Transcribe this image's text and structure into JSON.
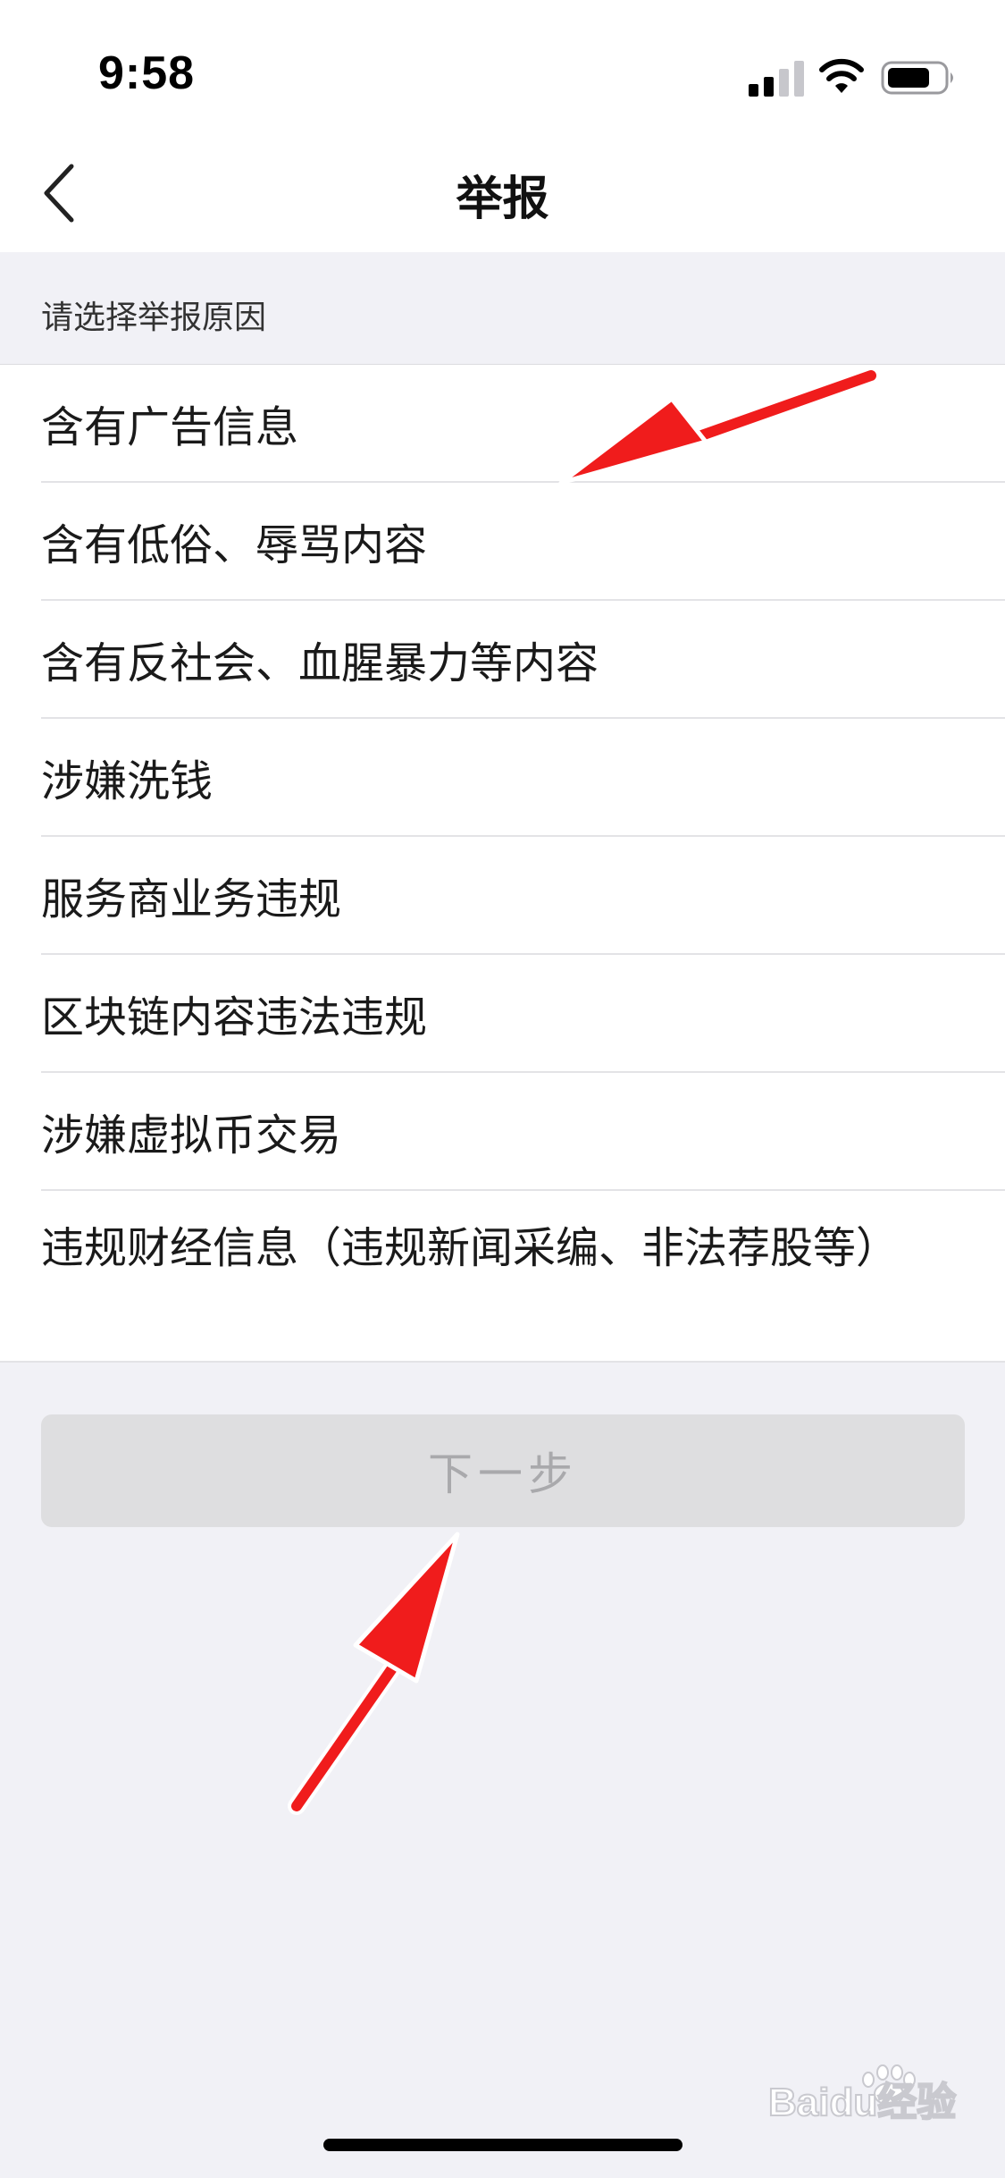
{
  "status_bar": {
    "time": "9:58"
  },
  "nav": {
    "title": "举报"
  },
  "section": {
    "label": "请选择举报原因"
  },
  "reasons": [
    "含有广告信息",
    "含有低俗、辱骂内容",
    "含有反社会、血腥暴力等内容",
    "涉嫌洗钱",
    "服务商业务违规",
    "区块链内容违法违规",
    "涉嫌虚拟币交易",
    "违规财经信息（违规新闻采编、非法荐股等）"
  ],
  "next_button": {
    "label": "下一步",
    "enabled": false
  },
  "watermark": {
    "text": "Baidu经验"
  },
  "colors": {
    "annotation_arrow": "#f01c1c",
    "button_disabled_bg": "#dedee0"
  }
}
